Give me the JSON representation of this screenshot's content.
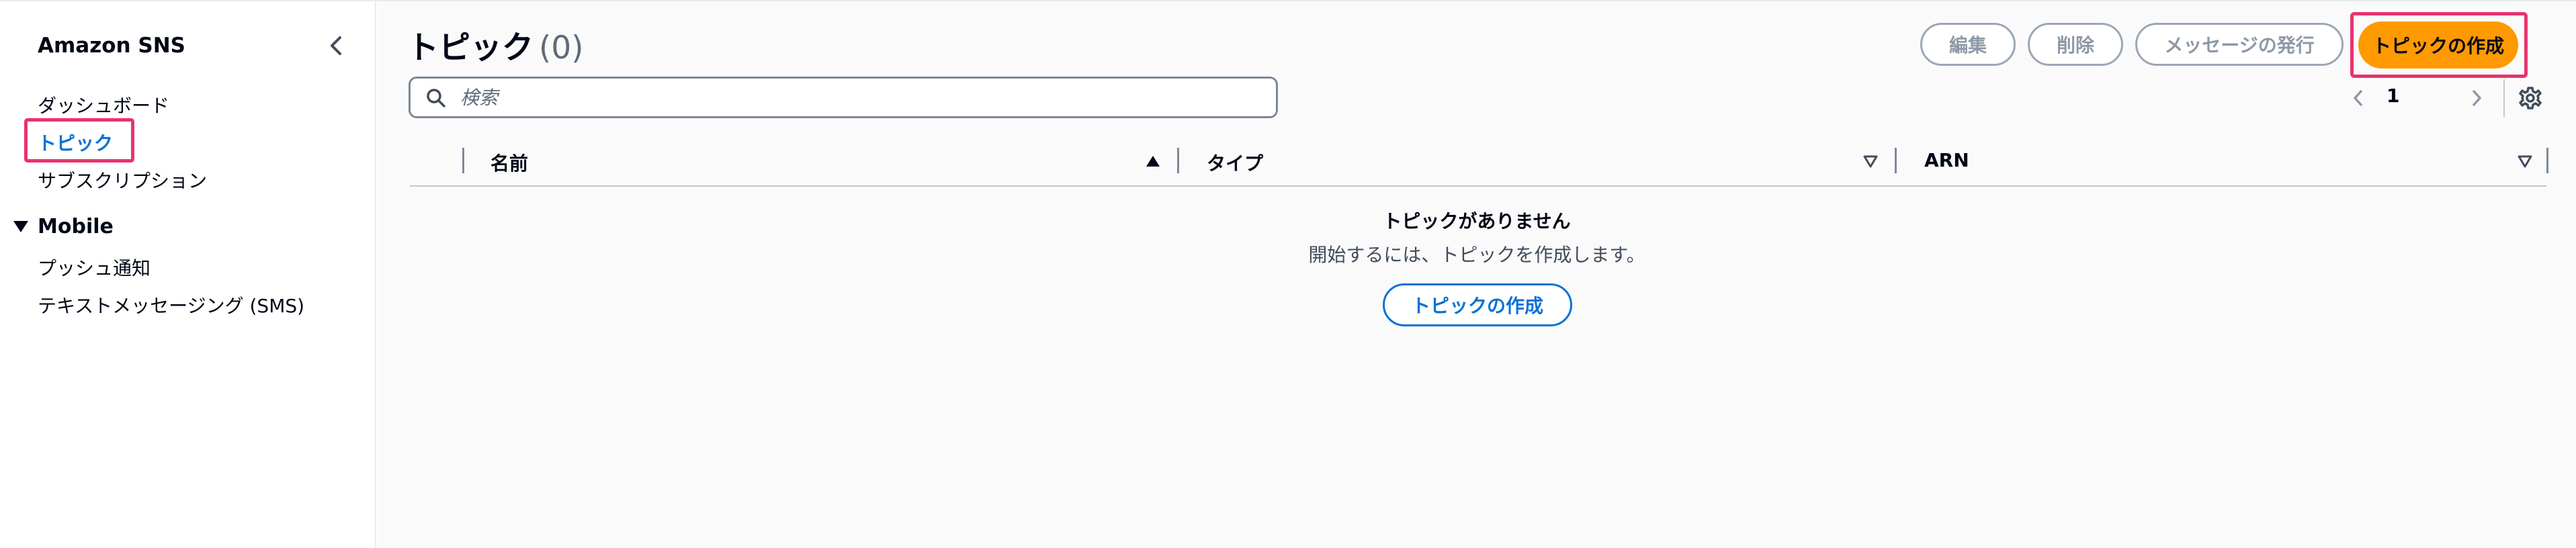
{
  "sidebar": {
    "title": "Amazon SNS",
    "items": [
      {
        "label": "ダッシュボード"
      },
      {
        "label": "トピック"
      },
      {
        "label": "サブスクリプション"
      }
    ],
    "section": {
      "label": "Mobile",
      "items": [
        {
          "label": "プッシュ通知"
        },
        {
          "label": "テキストメッセージング (SMS)"
        }
      ]
    }
  },
  "header": {
    "title": "トピック",
    "count": "(0)",
    "buttons": {
      "edit": "編集",
      "delete": "削除",
      "publish": "メッセージの発行",
      "create": "トピックの作成"
    }
  },
  "search": {
    "placeholder": "検索"
  },
  "pagination": {
    "current_page": "1"
  },
  "table": {
    "columns": [
      "名前",
      "タイプ",
      "ARN"
    ]
  },
  "empty_state": {
    "title": "トピックがありません",
    "description": "開始するには、トピックを作成します。",
    "button": "トピックの作成"
  },
  "colors": {
    "accent": "#0972d3",
    "primary_button": "#ff9900",
    "highlight": "#e8336e"
  }
}
